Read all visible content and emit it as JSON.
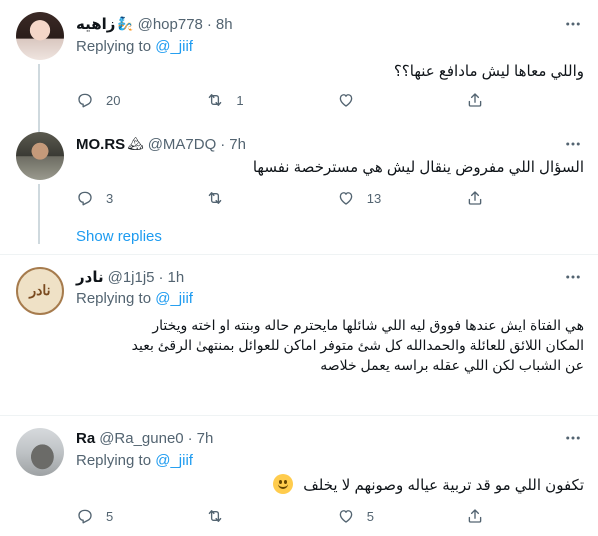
{
  "tweets": [
    {
      "name": "زاهيه",
      "emoji": "🧞",
      "handle": "@hop778",
      "time": "8h",
      "replying_prefix": "Replying to ",
      "replying_to": "@_jiif",
      "text": "واللي معاها ليش مادافع عنها؟؟",
      "replies": "20",
      "retweets": "1",
      "likes": ""
    },
    {
      "name": "MO.RS",
      "emoji": "🏔",
      "handle": "@MA7DQ",
      "time": "7h",
      "text": "السؤال اللي مفروض ينقال ليش هي مسترخصة نفسها",
      "replies": "3",
      "retweets": "",
      "likes": "13"
    },
    {
      "name": "نادر",
      "handle": "@1j1j5",
      "time": "1h",
      "avatar_text": "نادر",
      "replying_prefix": "Replying to ",
      "replying_to": "@_jiif",
      "text_lines": [
        "هي الفتاة ايش عندها فووق  ليه اللي شائلها مايحترم حاله وبنته او اخته ويختار",
        "المكان اللائق للعائلة والحمدالله كل شئ متوفر اماكن للعوائل بمنتهىٰ الرقئ  بعيد",
        "عن الشباب لكن اللي عقله براسه يعمل خلاصه"
      ],
      "replies": "",
      "retweets": "",
      "likes": ""
    },
    {
      "name": "Ra",
      "handle": "@Ra_gune0",
      "time": "7h",
      "replying_prefix": "Replying to ",
      "replying_to": "@_jiif",
      "text": "تكفون اللي مو قد تربية عياله وصونهم لا يخلف",
      "replies": "5",
      "retweets": "",
      "likes": "5"
    }
  ],
  "show_replies": "Show replies",
  "separator_dot": "·",
  "colors": {
    "accent": "#1d9bf0",
    "secondary_text": "#536471",
    "divider": "#eff3f4",
    "thread_line": "#cfd9de"
  },
  "icons": [
    "more-icon",
    "reply-icon",
    "retweet-icon",
    "like-icon",
    "share-icon"
  ]
}
